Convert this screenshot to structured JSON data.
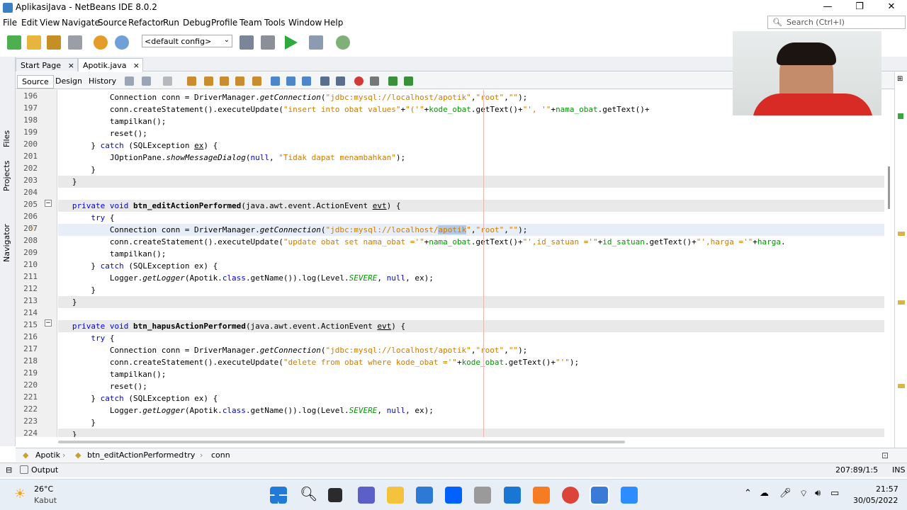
{
  "window": {
    "title": "AplikasiJava - NetBeans IDE 8.0.2",
    "min": "—",
    "max": "❐",
    "close": "✕"
  },
  "menu": [
    "File",
    "Edit",
    "View",
    "Navigate",
    "Source",
    "Refactor",
    "Run",
    "Debug",
    "Profile",
    "Team",
    "Tools",
    "Window",
    "Help"
  ],
  "search": {
    "placeholder": "Search (Ctrl+I)"
  },
  "toolbar": {
    "config": "<default config>"
  },
  "side_tools": [
    "Files",
    "Projects",
    "Navigator"
  ],
  "tabs": [
    {
      "label": "Start Page"
    },
    {
      "label": "Apotik.java"
    }
  ],
  "editor_tabs": [
    "Source",
    "Design",
    "History"
  ],
  "code": {
    "lines": [
      "196",
      "197",
      "198",
      "199",
      "200",
      "201",
      "202",
      "203",
      "204",
      "205",
      "206",
      "207",
      "208",
      "209",
      "210",
      "211",
      "212",
      "213",
      "214",
      "215",
      "216",
      "217",
      "218",
      "219",
      "220",
      "221",
      "222",
      "223",
      "224"
    ]
  },
  "breadcrumbs": [
    "Apotik",
    "btn_editActionPerformed",
    "try",
    "conn"
  ],
  "output": {
    "label": "Output",
    "position": "207:89/1:5",
    "mode": "INS"
  },
  "taskbar": {
    "weather_temp": "26°C",
    "weather_desc": "Kabut",
    "time": "21:57",
    "date": "30/05/2022"
  },
  "colors": {
    "keyword": "#0000e6",
    "string": "#ce7b00",
    "field": "#009900"
  }
}
